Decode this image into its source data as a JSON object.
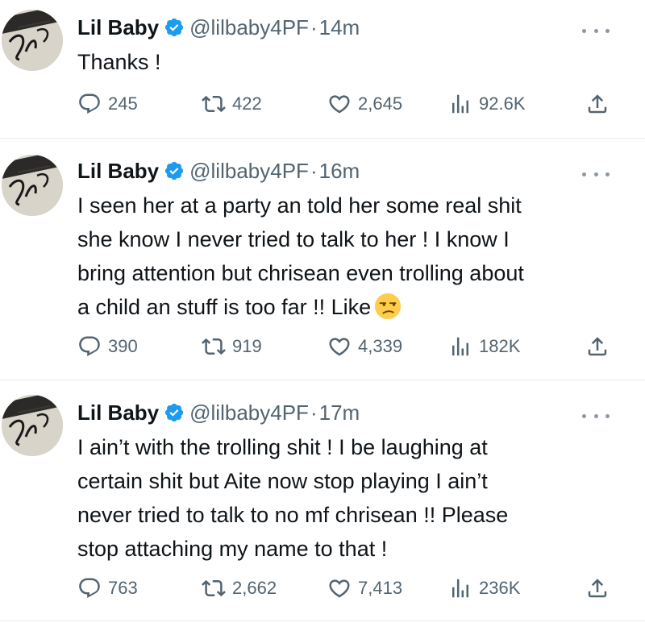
{
  "tweets": [
    {
      "name": "Lil Baby",
      "handle": "@lilbaby4PF",
      "separator": "·",
      "time": "14m",
      "text_lines": [
        "Thanks !"
      ],
      "has_emoji": false,
      "replies": "245",
      "retweets": "422",
      "likes": "2,645",
      "views": "92.6K"
    },
    {
      "name": "Lil Baby",
      "handle": "@lilbaby4PF",
      "separator": "·",
      "time": "16m",
      "text_lines": [
        "I seen her at a party an told her some real shit",
        "she know I never tried to talk to her ! I know I",
        "bring attention but chrisean even trolling about",
        "a child an stuff is too far !! Like"
      ],
      "has_emoji": true,
      "emoji": "unamused-face",
      "replies": "390",
      "retweets": "919",
      "likes": "4,339",
      "views": "182K"
    },
    {
      "name": "Lil Baby",
      "handle": "@lilbaby4PF",
      "separator": "·",
      "time": "17m",
      "text_lines": [
        "I ain’t with the trolling shit  ! I be laughing at",
        "certain shit but Aite now stop playing I ain’t",
        "never tried to talk to no mf chrisean !! Please",
        "stop attaching my name to that !"
      ],
      "has_emoji": false,
      "replies": "763",
      "retweets": "2,662",
      "likes": "7,413",
      "views": "236K"
    }
  ],
  "colors": {
    "verified": "#1d9bf0",
    "secondary_text": "#536471",
    "primary_text": "#0f1419",
    "divider": "#e6e9ec"
  },
  "icons": {
    "reply": "reply-icon",
    "retweet": "retweet-icon",
    "like": "heart-icon",
    "views": "views-icon",
    "share": "share-icon",
    "more": "more-icon",
    "verified": "verified-badge-icon"
  }
}
